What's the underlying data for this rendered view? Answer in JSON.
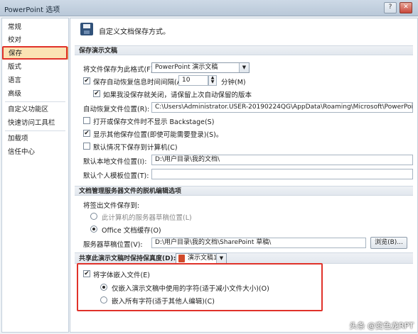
{
  "window": {
    "title": "PowerPoint 选项",
    "help_glyph": "?",
    "close_glyph": "✕"
  },
  "sidebar": {
    "items": [
      {
        "label": "常规"
      },
      {
        "label": "校对"
      },
      {
        "label": "保存",
        "selected": true
      },
      {
        "label": "版式"
      },
      {
        "label": "语言"
      },
      {
        "label": "高级"
      },
      {
        "label": "自定义功能区"
      },
      {
        "label": "快速访问工具栏"
      },
      {
        "label": "加载项"
      },
      {
        "label": "信任中心"
      }
    ]
  },
  "header": {
    "icon": "save-icon",
    "text": "自定义文档保存方式。"
  },
  "save_presentations": {
    "title": "保存演示文稿",
    "format_label": "将文件保存为此格式(F):",
    "format_value": "PowerPoint 演示文稿",
    "autorecover_label": "保存自动恢复信息时间间隔(A)",
    "autorecover_checked": true,
    "autorecover_minutes": "10",
    "minutes_unit": "分钟(M)",
    "keep_last_label": "如果我没保存就关闭，请保留上次自动保留的版本",
    "keep_last_checked": true,
    "autorecover_location_label": "自动恢复文件位置(R):",
    "autorecover_location_value": "C:\\Users\\Administrator.USER-20190224QG\\AppData\\Roaming\\Microsoft\\PowerPoint\\",
    "no_backstage_label": "打开或保存文件时不显示 Backstage(S)",
    "no_backstage_checked": false,
    "show_more_label": "显示其他保存位置(即使可能需要登录)(S)。",
    "show_more_checked": true,
    "default_computer_label": "默认情况下保存到计算机(C)",
    "default_computer_checked": false,
    "local_location_label": "默认本地文件位置(I):",
    "local_location_value": "D:\\用户目录\\我的文档\\",
    "personal_template_label": "默认个人模板位置(T):",
    "personal_template_value": ""
  },
  "offline_editing": {
    "title": "文档管理服务器文件的脱机编辑选项",
    "save_checked_out_label": "将签出文件保存到:",
    "opt_server_drafts": "此计算机的服务器草稿位置(L)",
    "opt_office_cache": "Office 文档缓存(O)",
    "drafts_location_label": "服务器草稿位置(V):",
    "drafts_location_value": "D:\\用户目录\\我的文档\\SharePoint 草稿\\",
    "browse_label": "浏览(B)..."
  },
  "fidelity": {
    "title": "共享此演示文稿时保持保真度(D):",
    "presentation": "演示文稿1",
    "embed_fonts_label": "将字体嵌入文件(E)",
    "embed_fonts_checked": true,
    "opt_used_chars": "仅嵌入演示文稿中使用的字符(适于减小文件大小)(O)",
    "opt_all_chars": "嵌入所有字符(适于其他人编辑)(C)"
  },
  "watermark": "头条 @变色龙RPT"
}
